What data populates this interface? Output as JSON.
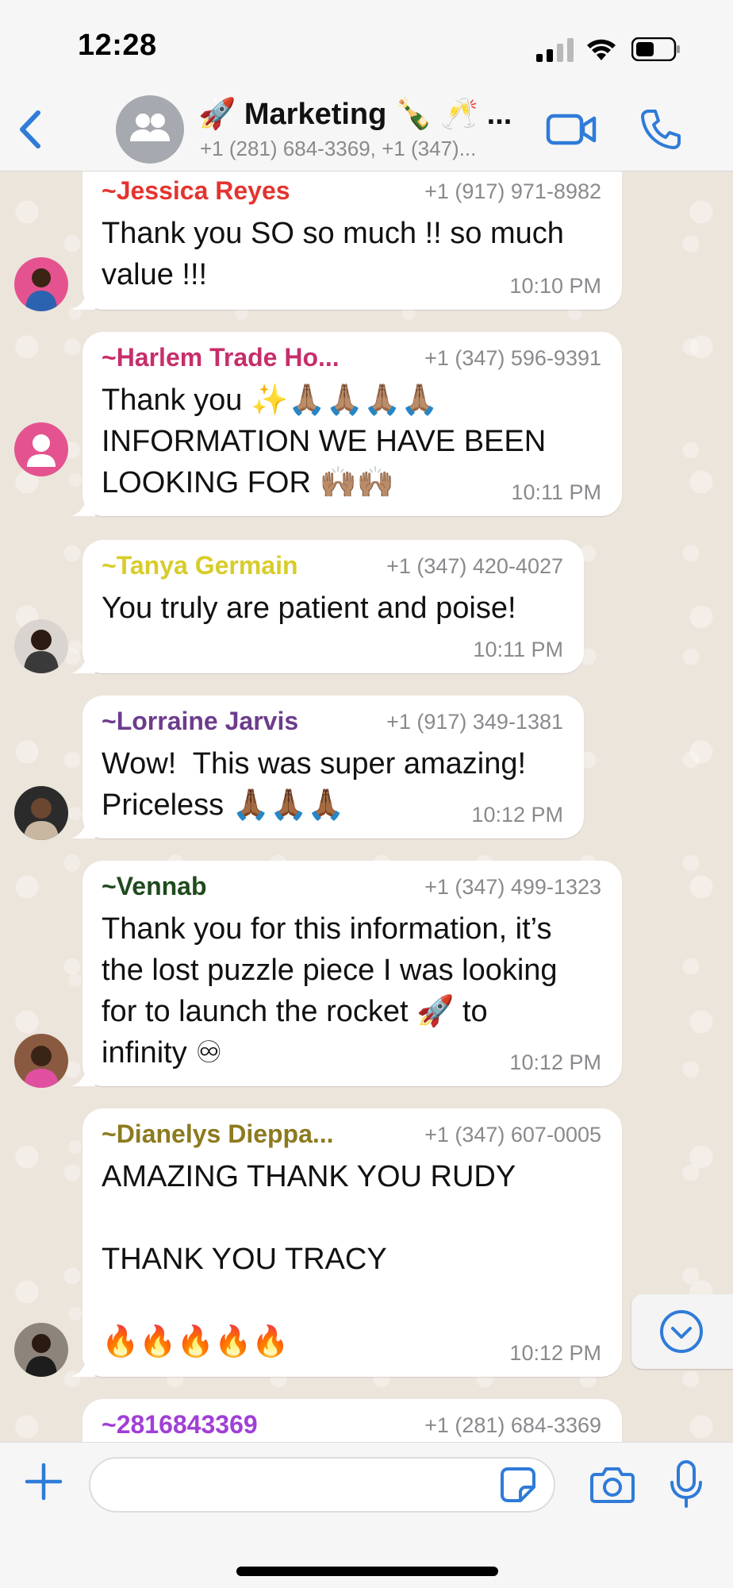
{
  "status_bar": {
    "time": "12:28"
  },
  "header": {
    "title": "🚀 Marketing 🍾 🥂 ...",
    "subtitle": "+1 (281) 684-3369, +1 (347)..."
  },
  "messages": [
    {
      "sender": "~Jessica Reyes",
      "sender_color": "#e4342f",
      "phone": "+1 (917) 971-8982",
      "text": "Thank you SO so much !! so much\nvalue !!!",
      "time": "10:10 PM"
    },
    {
      "sender": "~Harlem Trade Ho...",
      "sender_color": "#c62e6a",
      "phone": "+1 (347) 596-9391",
      "text": "Thank you ✨🙏🏽🙏🏽🙏🏽🙏🏽\nINFORMATION WE HAVE BEEN\nLOOKING FOR 🙌🏽🙌🏽",
      "time": "10:11 PM"
    },
    {
      "sender": "~Tanya Germain",
      "sender_color": "#d8cc2a",
      "phone": "+1 (347) 420-4027",
      "text": "You truly are patient and poise!",
      "time": "10:11 PM"
    },
    {
      "sender": "~Lorraine Jarvis",
      "sender_color": "#6d3c8c",
      "phone": "+1 (917) 349-1381",
      "text": "Wow!  This was super amazing!\nPriceless 🙏🏾🙏🏾🙏🏾",
      "time": "10:12 PM"
    },
    {
      "sender": "~Vennab",
      "sender_color": "#1f4a1d",
      "phone": "+1 (347) 499-1323",
      "text": "Thank you for this information, it’s\nthe lost puzzle piece I was looking\nfor to launch the rocket 🚀 to\ninfinity ♾",
      "time": "10:12 PM"
    },
    {
      "sender": "~Dianelys Dieppa...",
      "sender_color": "#8c7a1e",
      "phone": "+1 (347) 607-0005",
      "text": "AMAZING THANK YOU RUDY\n\nTHANK YOU TRACY\n\n🔥🔥🔥🔥🔥",
      "time": "10:12 PM"
    },
    {
      "sender": "~2816843369",
      "sender_color": "#a03fd6",
      "phone": "+1 (281) 684-3369",
      "text": "",
      "time": ""
    }
  ],
  "input": {
    "placeholder": ""
  },
  "colors": {
    "accent": "#2f7bd8",
    "chat_background": "#ece5dc",
    "bubble": "#ffffff"
  },
  "icons": {
    "back": "chevron-left-icon",
    "group": "group-avatar-icon",
    "video": "video-camera-icon",
    "call": "phone-icon",
    "scroll": "chevron-down-circle-icon",
    "plus": "plus-icon",
    "sticker": "sticker-icon",
    "camera": "camera-icon",
    "mic": "microphone-icon"
  }
}
